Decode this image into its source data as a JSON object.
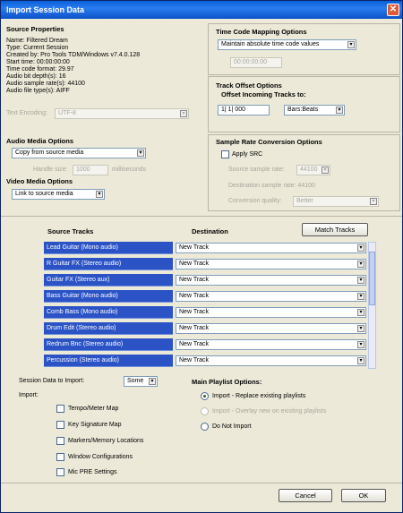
{
  "window": {
    "title": "Import Session Data"
  },
  "source_properties": {
    "heading": "Source Properties",
    "lines": [
      "Name: Filtered Dream",
      "Type: Current Session",
      "Created by: Pro Tools TDM/Windows v7.4.0.128",
      "Start time: 00:00:00:00",
      "Time code format: 29.97",
      "Audio bit depth(s): 16",
      "Audio sample rate(s): 44100",
      "Audio file type(s): AIFF"
    ],
    "text_encoding_label": "Text Encoding:",
    "text_encoding_value": "UTF-8"
  },
  "time_code": {
    "heading": "Time Code Mapping Options",
    "option": "Maintain absolute time code values",
    "value": "00:00:00:00"
  },
  "track_offset": {
    "heading": "Track Offset Options",
    "label": "Offset Incoming Tracks to:",
    "value": "1| 1| 000",
    "unit": "Bars:Beats"
  },
  "audio_media": {
    "heading": "Audio Media Options",
    "option": "Copy from source media",
    "handle_label": "Handle size:",
    "handle_value": "1000",
    "handle_unit": "milliseconds"
  },
  "video_media": {
    "heading": "Video Media Options",
    "option": "Link to source media"
  },
  "sample_rate": {
    "heading": "Sample Rate Conversion Options",
    "apply_label": "Apply SRC",
    "source_label": "Source sample rate:",
    "source_value": "44100",
    "dest_label": "Destination sample rate: 44100",
    "quality_label": "Conversion quality:",
    "quality_value": "Better"
  },
  "tracks": {
    "col_source": "Source Tracks",
    "col_destination": "Destination",
    "match_button": "Match Tracks",
    "rows": [
      {
        "source": "Lead Guitar (Mono audio)",
        "destination": "New Track"
      },
      {
        "source": "R Guitar FX (Stereo audio)",
        "destination": "New Track"
      },
      {
        "source": "Guitar FX (Stereo aux)",
        "destination": "New Track"
      },
      {
        "source": "Bass Guitar (Mono audio)",
        "destination": "New Track"
      },
      {
        "source": "Comb Bass (Mono audio)",
        "destination": "New Track"
      },
      {
        "source": "Drum Edit (Stereo audio)",
        "destination": "New Track"
      },
      {
        "source": "Redrum Bnc (Stereo audio)",
        "destination": "New Track"
      },
      {
        "source": "Percussion (Stereo audio)",
        "destination": "New Track"
      }
    ]
  },
  "session_data": {
    "label": "Session Data to Import:",
    "value": "Some",
    "import_label": "Import:",
    "items": [
      "Tempo/Meter Map",
      "Key Signature Map",
      "Markers/Memory Locations",
      "Window Configurations",
      "Mic PRE Settings"
    ]
  },
  "playlist": {
    "heading": "Main Playlist Options:",
    "options": [
      "Import - Replace existing playlists",
      "Import - Overlay new on existing playlists",
      "Do Not Import"
    ]
  },
  "footer": {
    "cancel": "Cancel",
    "ok": "OK"
  }
}
